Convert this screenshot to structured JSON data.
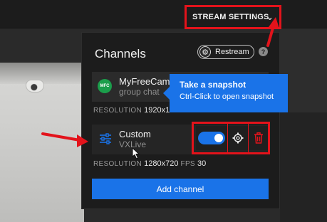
{
  "header": {
    "stream_settings_label": "STREAM SETTINGS",
    "stream_settings_icon": "chevron-down-icon"
  },
  "panel": {
    "title": "Channels",
    "restream_label": "Restream",
    "help_label": "?"
  },
  "channels": [
    {
      "logo_text": "MFC",
      "name": "MyFreeCams",
      "subtitle": "group chat",
      "resolution_label": "RESOLUTION",
      "resolution_value": "1920x10"
    },
    {
      "icon": "sliders-icon",
      "name": "Custom",
      "subtitle": "VXLive",
      "resolution_label": "RESOLUTION",
      "resolution_value": "1280x720",
      "fps_label": "FPS",
      "fps_value": "30",
      "enabled": true
    }
  ],
  "add_channel_label": "Add channel",
  "tooltip": {
    "title": "Take a snapshot",
    "body": "Ctrl-Click to open snapshot"
  },
  "colors": {
    "accent": "#1a73e8",
    "annotation_red": "#e3131b",
    "mfc_green": "#1b9e4b"
  }
}
